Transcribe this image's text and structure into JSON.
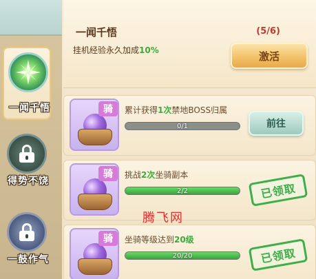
{
  "skills": [
    {
      "label": "一闻千悟",
      "state": "active",
      "icon": "green-star-burst-icon"
    },
    {
      "label": "得势不饶",
      "state": "locked",
      "icon": "lock-icon"
    },
    {
      "label": "一鼓作气",
      "state": "locked",
      "icon": "lock-icon"
    }
  ],
  "header": {
    "title": "一闻千悟",
    "progress": "(5/6)",
    "desc_prefix": "挂机经验永久加成",
    "desc_value": "10%",
    "activate_label": "激活"
  },
  "tasks": [
    {
      "badge": "骑",
      "desc_prefix": "累计获得",
      "desc_highlight": "1次",
      "desc_suffix": "禁地BOSS归属",
      "progress_text": "0/1",
      "progress": 0.0,
      "action_label": "前往",
      "status": "go"
    },
    {
      "badge": "骑",
      "desc_prefix": "挑战",
      "desc_highlight": "2次",
      "desc_suffix": "坐骑副本",
      "progress_text": "2/2",
      "progress": 1.0,
      "action_label": "已领取",
      "status": "claimed"
    },
    {
      "badge": "骑",
      "desc_prefix": "坐骑等级达到",
      "desc_highlight": "20级",
      "desc_suffix": "",
      "progress_text": "20/20",
      "progress": 1.0,
      "action_label": "已领取",
      "status": "claimed"
    }
  ],
  "watermark": "腾飞网",
  "colors": {
    "highlight_green": "#3daa3d",
    "progress_red": "#c0392b",
    "stamp_green": "#3fae4a"
  }
}
